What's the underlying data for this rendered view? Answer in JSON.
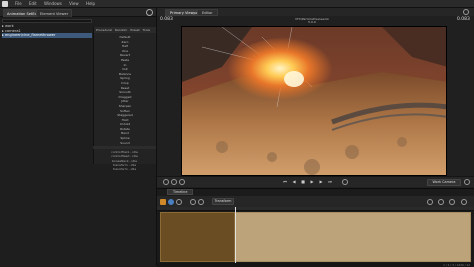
{
  "menubar": {
    "items": [
      "File",
      "Edit",
      "Windows",
      "View",
      "Help"
    ]
  },
  "left_panel": {
    "tabs": [
      "Animation SetEditor",
      "Element Viewer"
    ],
    "tree": [
      {
        "label": "work",
        "selected": false
      },
      {
        "label": "camera1",
        "selected": false
      },
      {
        "label": "engineer/cine_flamethrower",
        "selected": true
      }
    ],
    "anim_tabs": [
      "Procedural",
      "Random",
      "Preset",
      "Tools"
    ],
    "anim_items": [
      "Default",
      "Zero",
      "Half",
      "One",
      "Revert",
      "Paste",
      "In",
      "Out",
      "Balance",
      "Spring",
      "Drop",
      "Reset",
      "Smooth",
      "Dragged",
      "Jitter",
      "Sharpen",
      "Soften",
      "Staggered",
      "Hold",
      "Unhold",
      "Rotate",
      "Bend",
      "Spline",
      "Sound"
    ],
    "bottom_items": [
      "controlTrack - idle",
      "controlHead - idle",
      "bonesNeck - idle",
      "transform - idle",
      "transform - idle"
    ]
  },
  "viewer": {
    "tabs": [
      "Primary Viewport",
      "Editor"
    ],
    "frame_left": "0.083",
    "frame_right": "0.083",
    "title_lines": [
      "VFX/ParticlePreview.bk",
      "5.0.0"
    ],
    "work_camera_label": "Work Camera"
  },
  "timeline": {
    "tab_label": "Timeline",
    "transform_label": "Transform",
    "status_left": "",
    "status_right": "1 / 2 / 3 / 1234 / 12"
  }
}
